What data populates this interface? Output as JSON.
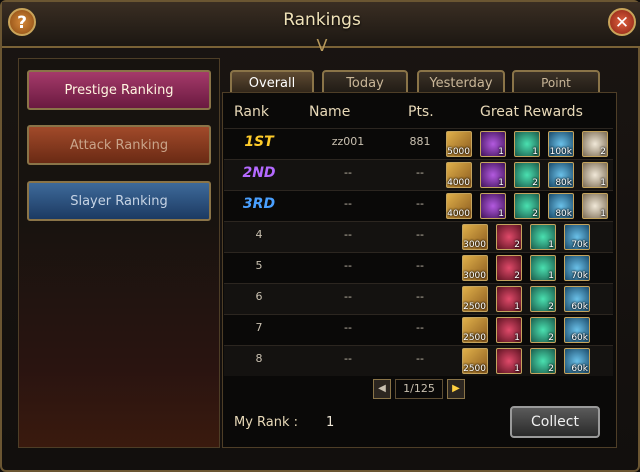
{
  "window": {
    "title": "Rankings"
  },
  "icons": {
    "help": "?",
    "close": "✕",
    "ornament": "ᐯ"
  },
  "sidebar": {
    "items": [
      {
        "label": "Prestige Ranking",
        "active": true
      },
      {
        "label": "Attack Ranking",
        "active": false
      },
      {
        "label": "Slayer Ranking",
        "active": false
      }
    ]
  },
  "tabs": [
    {
      "label": "Overall",
      "active": true
    },
    {
      "label": "Today",
      "active": false
    },
    {
      "label": "Yesterday",
      "active": false
    },
    {
      "label": "Point Rewards",
      "active": false
    }
  ],
  "table": {
    "headers": {
      "rank": "Rank",
      "name": "Name",
      "pts": "Pts.",
      "rewards": "Great Rewards"
    },
    "rows": [
      {
        "rank": "1ST",
        "name": "zz001",
        "pts": "881",
        "rewards": [
          {
            "icon": "orange",
            "label": "5000"
          },
          {
            "icon": "purple",
            "label": "1"
          },
          {
            "icon": "green",
            "label": "1"
          },
          {
            "icon": "blue",
            "label": "100k"
          },
          {
            "icon": "white",
            "label": "2"
          }
        ]
      },
      {
        "rank": "2ND",
        "name": "--",
        "pts": "--",
        "rewards": [
          {
            "icon": "orange",
            "label": "4000"
          },
          {
            "icon": "purple",
            "label": "1"
          },
          {
            "icon": "green",
            "label": "2"
          },
          {
            "icon": "blue",
            "label": "80k"
          },
          {
            "icon": "white",
            "label": "1"
          }
        ]
      },
      {
        "rank": "3RD",
        "name": "--",
        "pts": "--",
        "rewards": [
          {
            "icon": "orange",
            "label": "4000"
          },
          {
            "icon": "purple",
            "label": "1"
          },
          {
            "icon": "green",
            "label": "2"
          },
          {
            "icon": "blue",
            "label": "80k"
          },
          {
            "icon": "white",
            "label": "1"
          }
        ]
      },
      {
        "rank": "4",
        "name": "--",
        "pts": "--",
        "rewards": [
          {
            "icon": "orange",
            "label": "3000"
          },
          {
            "icon": "red",
            "label": "2"
          },
          {
            "icon": "green",
            "label": "1"
          },
          {
            "icon": "blue",
            "label": "70k"
          }
        ]
      },
      {
        "rank": "5",
        "name": "--",
        "pts": "--",
        "rewards": [
          {
            "icon": "orange",
            "label": "3000"
          },
          {
            "icon": "red",
            "label": "2"
          },
          {
            "icon": "green",
            "label": "1"
          },
          {
            "icon": "blue",
            "label": "70k"
          }
        ]
      },
      {
        "rank": "6",
        "name": "--",
        "pts": "--",
        "rewards": [
          {
            "icon": "orange",
            "label": "2500"
          },
          {
            "icon": "red",
            "label": "1"
          },
          {
            "icon": "green",
            "label": "2"
          },
          {
            "icon": "blue",
            "label": "60k"
          }
        ]
      },
      {
        "rank": "7",
        "name": "--",
        "pts": "--",
        "rewards": [
          {
            "icon": "orange",
            "label": "2500"
          },
          {
            "icon": "red",
            "label": "1"
          },
          {
            "icon": "green",
            "label": "2"
          },
          {
            "icon": "blue",
            "label": "60k"
          }
        ]
      },
      {
        "rank": "8",
        "name": "--",
        "pts": "--",
        "rewards": [
          {
            "icon": "orange",
            "label": "2500"
          },
          {
            "icon": "red",
            "label": "1"
          },
          {
            "icon": "green",
            "label": "2"
          },
          {
            "icon": "blue",
            "label": "60k"
          }
        ]
      }
    ]
  },
  "pager": {
    "prev": "◀",
    "next": "▶",
    "value": "1/125"
  },
  "footer": {
    "my_rank_label": "My Rank :",
    "my_rank_value": "1",
    "collect_label": "Collect"
  }
}
